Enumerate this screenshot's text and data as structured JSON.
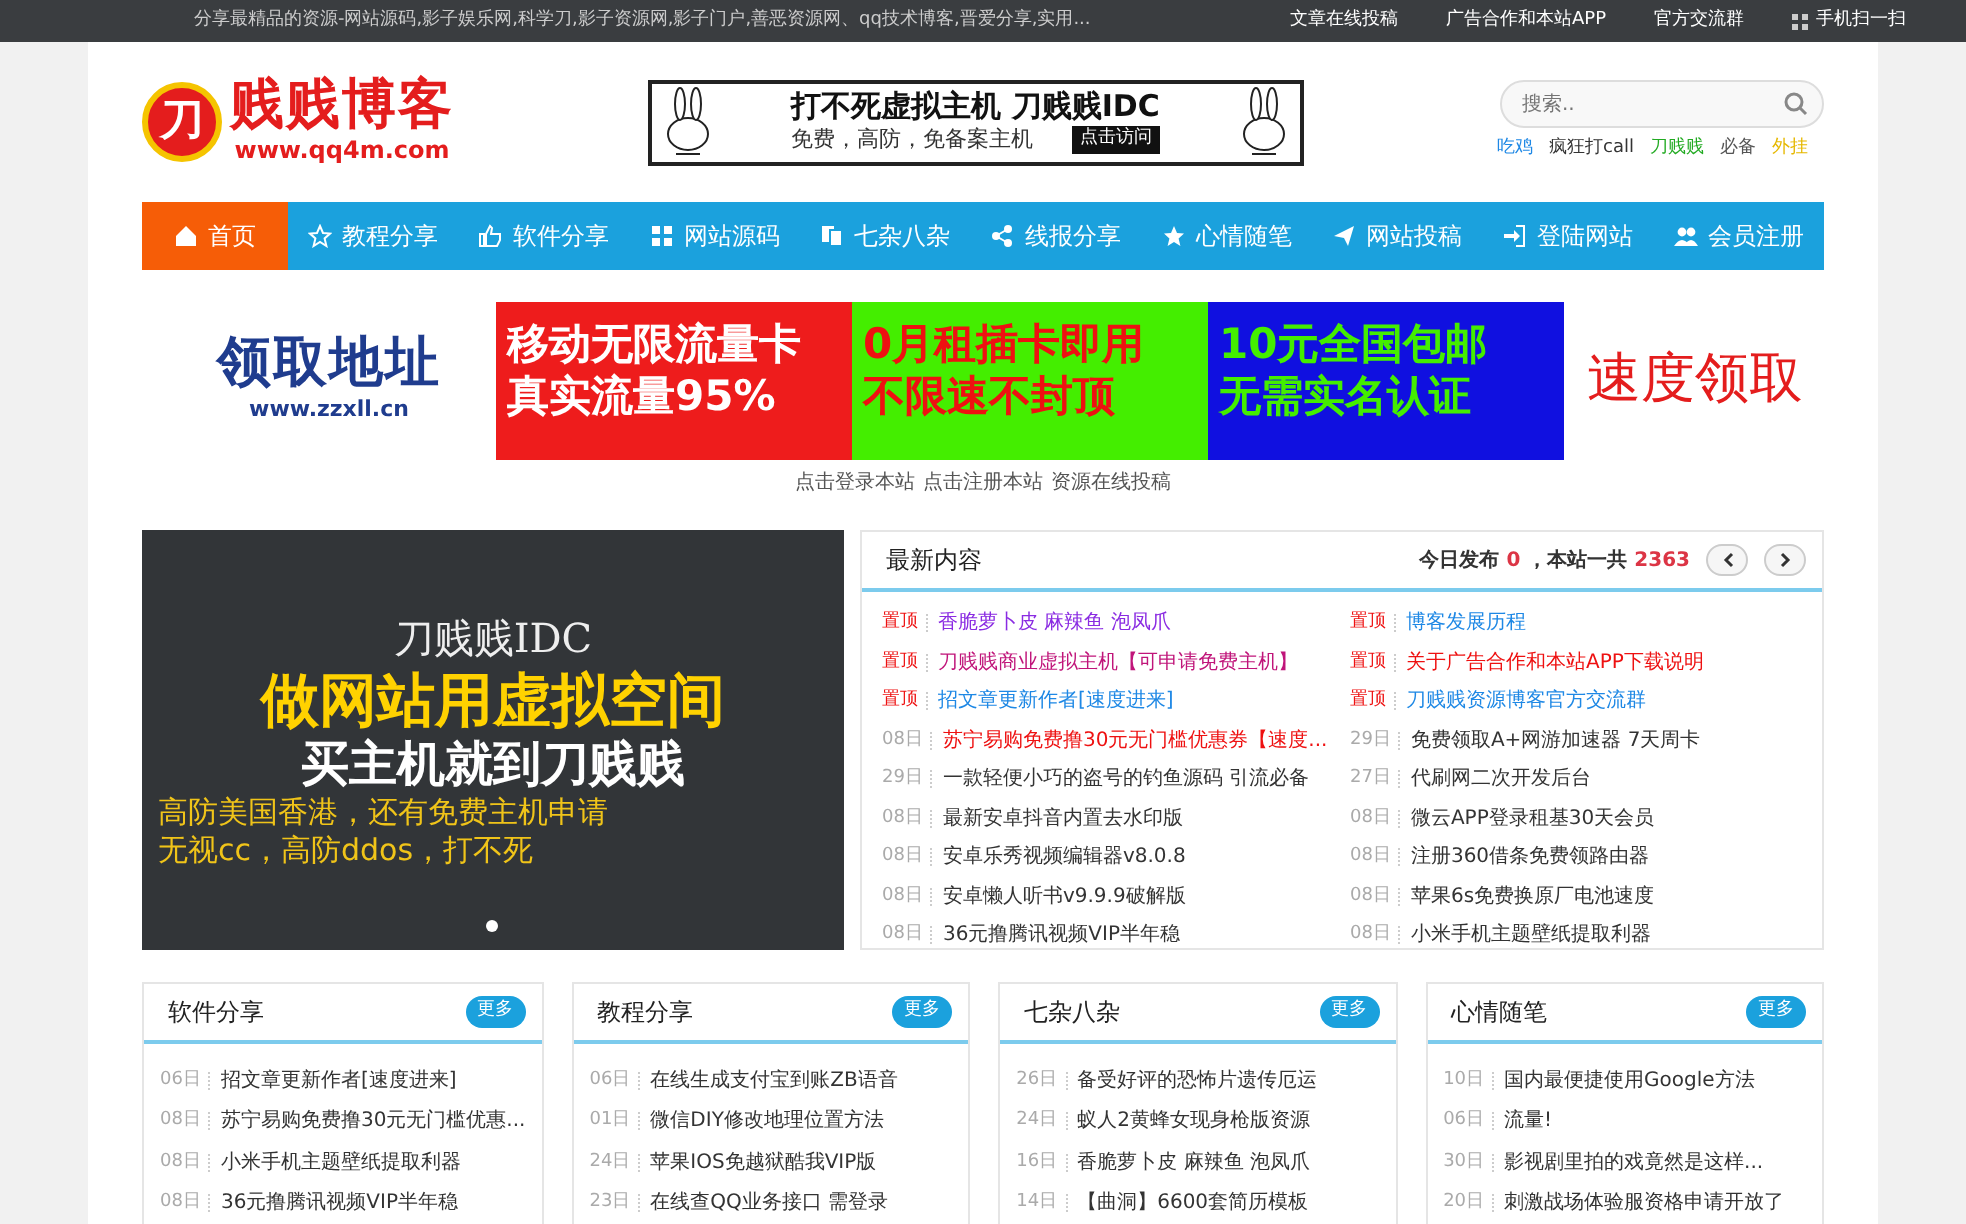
{
  "top_bar": {
    "tagline": "分享最精品的资源-网站源码,影子娱乐网,科学刀,影子资源网,影子门户,善恶资源网、qq技术博客,晋爱分享,实用...",
    "links": [
      "文章在线投稿",
      "广告合作和本站APP",
      "官方交流群",
      "手机扫一扫"
    ]
  },
  "header": {
    "logo": {
      "mark": "刀",
      "title": "贱贱博客",
      "url": "www.qq4m.com"
    },
    "ad": {
      "headline": "打不死虚拟主机 刀贱贱IDC",
      "subline": "免费，高防，免备案主机",
      "button": "点击访问"
    },
    "search": {
      "placeholder": "搜索..",
      "tags": [
        {
          "label": "吃鸡",
          "color": "#1e88e5"
        },
        {
          "label": "疯狂打call",
          "color": "#333333"
        },
        {
          "label": "刀贱贱",
          "color": "#22aa22"
        },
        {
          "label": "必备",
          "color": "#555555"
        },
        {
          "label": "外挂",
          "color": "#e6b800"
        }
      ]
    }
  },
  "nav": [
    {
      "label": "首页",
      "selected": true
    },
    {
      "label": "教程分享",
      "selected": false
    },
    {
      "label": "软件分享",
      "selected": false
    },
    {
      "label": "网站源码",
      "selected": false
    },
    {
      "label": "七杂八杂",
      "selected": false
    },
    {
      "label": "线报分享",
      "selected": false
    },
    {
      "label": "心情随笔",
      "selected": false
    },
    {
      "label": "网站投稿",
      "selected": false
    },
    {
      "label": "登陆网站",
      "selected": false
    },
    {
      "label": "会员注册",
      "selected": false
    }
  ],
  "banner": {
    "title": "领取地址",
    "url": "www.zzxll.cn",
    "tiles": [
      {
        "line1": "移动无限流量卡",
        "line2": "真实流量95%",
        "color": "#ee1c1c",
        "kind": "data"
      },
      {
        "line1": "0月租插卡即用",
        "line2": "不限速不封顶",
        "color": "#44ee00",
        "kind": "rental"
      },
      {
        "line1": "10元全国包邮",
        "line2": "无需实名认证",
        "color": "#1010e0",
        "kind": "shipping"
      }
    ],
    "action": "速度领取"
  },
  "quick_links": [
    "点击登录本站",
    "点击注册本站",
    "资源在线投稿"
  ],
  "slider": {
    "brand": "刀贱贱IDC",
    "headline": "做网站用虚拟空间",
    "subhead": "买主机就到刀贱贱",
    "lines": [
      "高防美国香港，还有免费主机申请",
      "无视cc，高防ddos，打不死"
    ]
  },
  "latest": {
    "title": "最新内容",
    "today_label": "今日发布",
    "today_count": "0",
    "total_label": "，本站一共",
    "total_count": "2363",
    "items": [
      {
        "tag": "置顶",
        "pinned": true,
        "title": "香脆萝卜皮 麻辣鱼 泡凤爪",
        "color": "#8a2be2"
      },
      {
        "tag": "置顶",
        "pinned": true,
        "title": "博客发展历程",
        "color": "#1e88e5"
      },
      {
        "tag": "置顶",
        "pinned": true,
        "title": "刀贱贱商业虚拟主机【可申请免费主机】",
        "color": "#c0157a"
      },
      {
        "tag": "置顶",
        "pinned": true,
        "title": "关于广告合作和本站APP下载说明",
        "color": "#ee1111"
      },
      {
        "tag": "置顶",
        "pinned": true,
        "title": "招文章更新作者[速度进来]",
        "color": "#1e88e5"
      },
      {
        "tag": "置顶",
        "pinned": true,
        "title": "刀贱贱资源博客官方交流群",
        "color": "#1e88e5"
      },
      {
        "tag": "08日",
        "pinned": false,
        "title": "苏宁易购免费撸30元无门槛优惠券【速度...",
        "color": "#ee1111"
      },
      {
        "tag": "29日",
        "pinned": false,
        "title": "免费领取A+网游加速器 7天周卡",
        "color": "#333333"
      },
      {
        "tag": "29日",
        "pinned": false,
        "title": "一款轻便小巧的盗号的钓鱼源码 引流必备",
        "color": "#333333"
      },
      {
        "tag": "27日",
        "pinned": false,
        "title": "代刷网二次开发后台",
        "color": "#333333"
      },
      {
        "tag": "08日",
        "pinned": false,
        "title": "最新安卓抖音内置去水印版",
        "color": "#333333"
      },
      {
        "tag": "08日",
        "pinned": false,
        "title": "微云APP登录租基30天会员",
        "color": "#333333"
      },
      {
        "tag": "08日",
        "pinned": false,
        "title": "安卓乐秀视频编辑器v8.0.8",
        "color": "#333333"
      },
      {
        "tag": "08日",
        "pinned": false,
        "title": "注册360借条免费领路由器",
        "color": "#333333"
      },
      {
        "tag": "08日",
        "pinned": false,
        "title": "安卓懒人听书v9.9.9破解版",
        "color": "#333333"
      },
      {
        "tag": "08日",
        "pinned": false,
        "title": "苹果6s免费换原厂电池速度",
        "color": "#333333"
      },
      {
        "tag": "08日",
        "pinned": false,
        "title": "36元撸腾讯视频VIP半年稳",
        "color": "#333333"
      },
      {
        "tag": "08日",
        "pinned": false,
        "title": "小米手机主题壁纸提取利器",
        "color": "#333333"
      }
    ]
  },
  "cards": [
    {
      "title": "软件分享",
      "more": "更多",
      "items": [
        {
          "day": "06日",
          "title": "招文章更新作者[速度进来]"
        },
        {
          "day": "08日",
          "title": "苏宁易购免费撸30元无门槛优惠..."
        },
        {
          "day": "08日",
          "title": "小米手机主题壁纸提取利器"
        },
        {
          "day": "08日",
          "title": "36元撸腾讯视频VIP半年稳"
        }
      ]
    },
    {
      "title": "教程分享",
      "more": "更多",
      "items": [
        {
          "day": "06日",
          "title": "在线生成支付宝到账ZB语音"
        },
        {
          "day": "01日",
          "title": "微信DIY修改地理位置方法"
        },
        {
          "day": "24日",
          "title": "苹果IOS免越狱酷我VIP版"
        },
        {
          "day": "23日",
          "title": "在线查QQ业务接口 需登录"
        }
      ]
    },
    {
      "title": "七杂八杂",
      "more": "更多",
      "items": [
        {
          "day": "26日",
          "title": "备受好评的恐怖片遗传厄运"
        },
        {
          "day": "24日",
          "title": "蚁人2黄蜂女现身枪版资源"
        },
        {
          "day": "16日",
          "title": "香脆萝卜皮 麻辣鱼 泡凤爪"
        },
        {
          "day": "14日",
          "title": "【曲洞】6600套简历模板"
        }
      ]
    },
    {
      "title": "心情随笔",
      "more": "更多",
      "items": [
        {
          "day": "10日",
          "title": "国内最便捷使用Google方法"
        },
        {
          "day": "06日",
          "title": "流量!"
        },
        {
          "day": "30日",
          "title": "影视剧里拍的戏竟然是这样..."
        },
        {
          "day": "20日",
          "title": "刺激战场体验服资格申请开放了"
        }
      ]
    }
  ]
}
